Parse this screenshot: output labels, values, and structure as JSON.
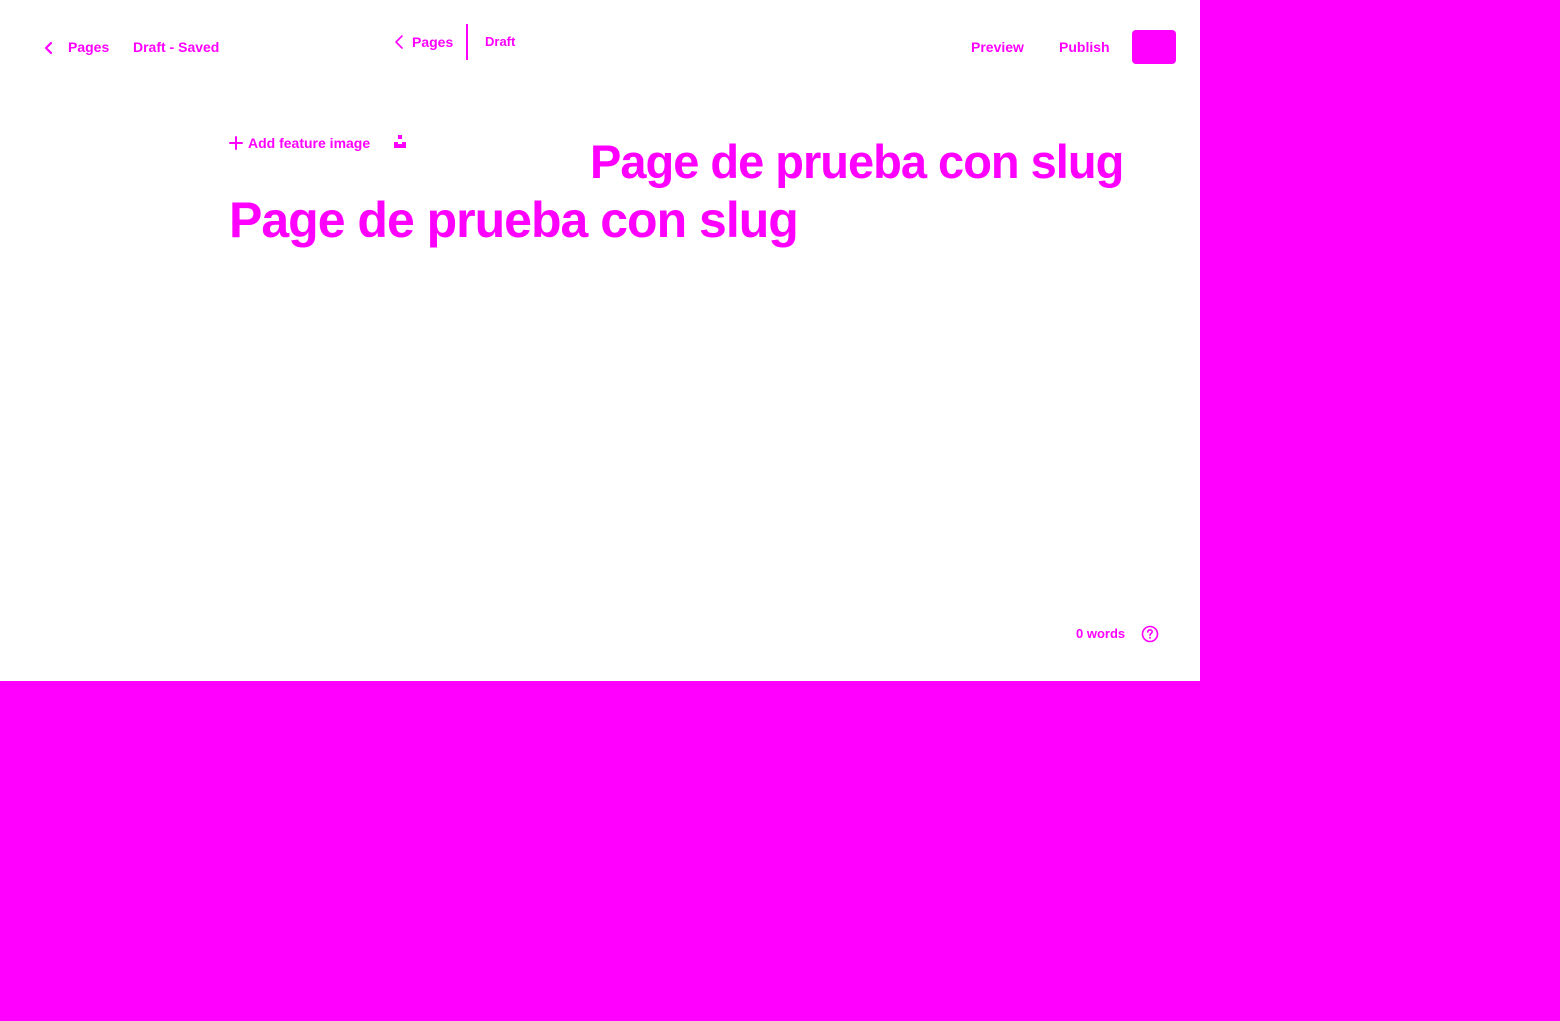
{
  "colors": {
    "accent": "#ff00ff",
    "surface": "#ffffff"
  },
  "header_left": {
    "back_icon": "chevron-left-icon",
    "pages_label": "Pages",
    "status_label": "Draft - Saved"
  },
  "header_center": {
    "back_icon": "chevron-left-icon",
    "pages_label": "Pages",
    "status_label": "Draft"
  },
  "header_right": {
    "preview_label": "Preview",
    "publish_label": "Publish",
    "settings_icon": "settings-icon"
  },
  "editor": {
    "feature_image_icon": "plus-icon",
    "feature_image_label": "Add feature image",
    "upload_icon": "upload-icon",
    "title_ghost": "Page de prueba con slug",
    "title": "Page de prueba con slug"
  },
  "footer": {
    "word_count": "0 words",
    "help_icon": "help-icon"
  }
}
